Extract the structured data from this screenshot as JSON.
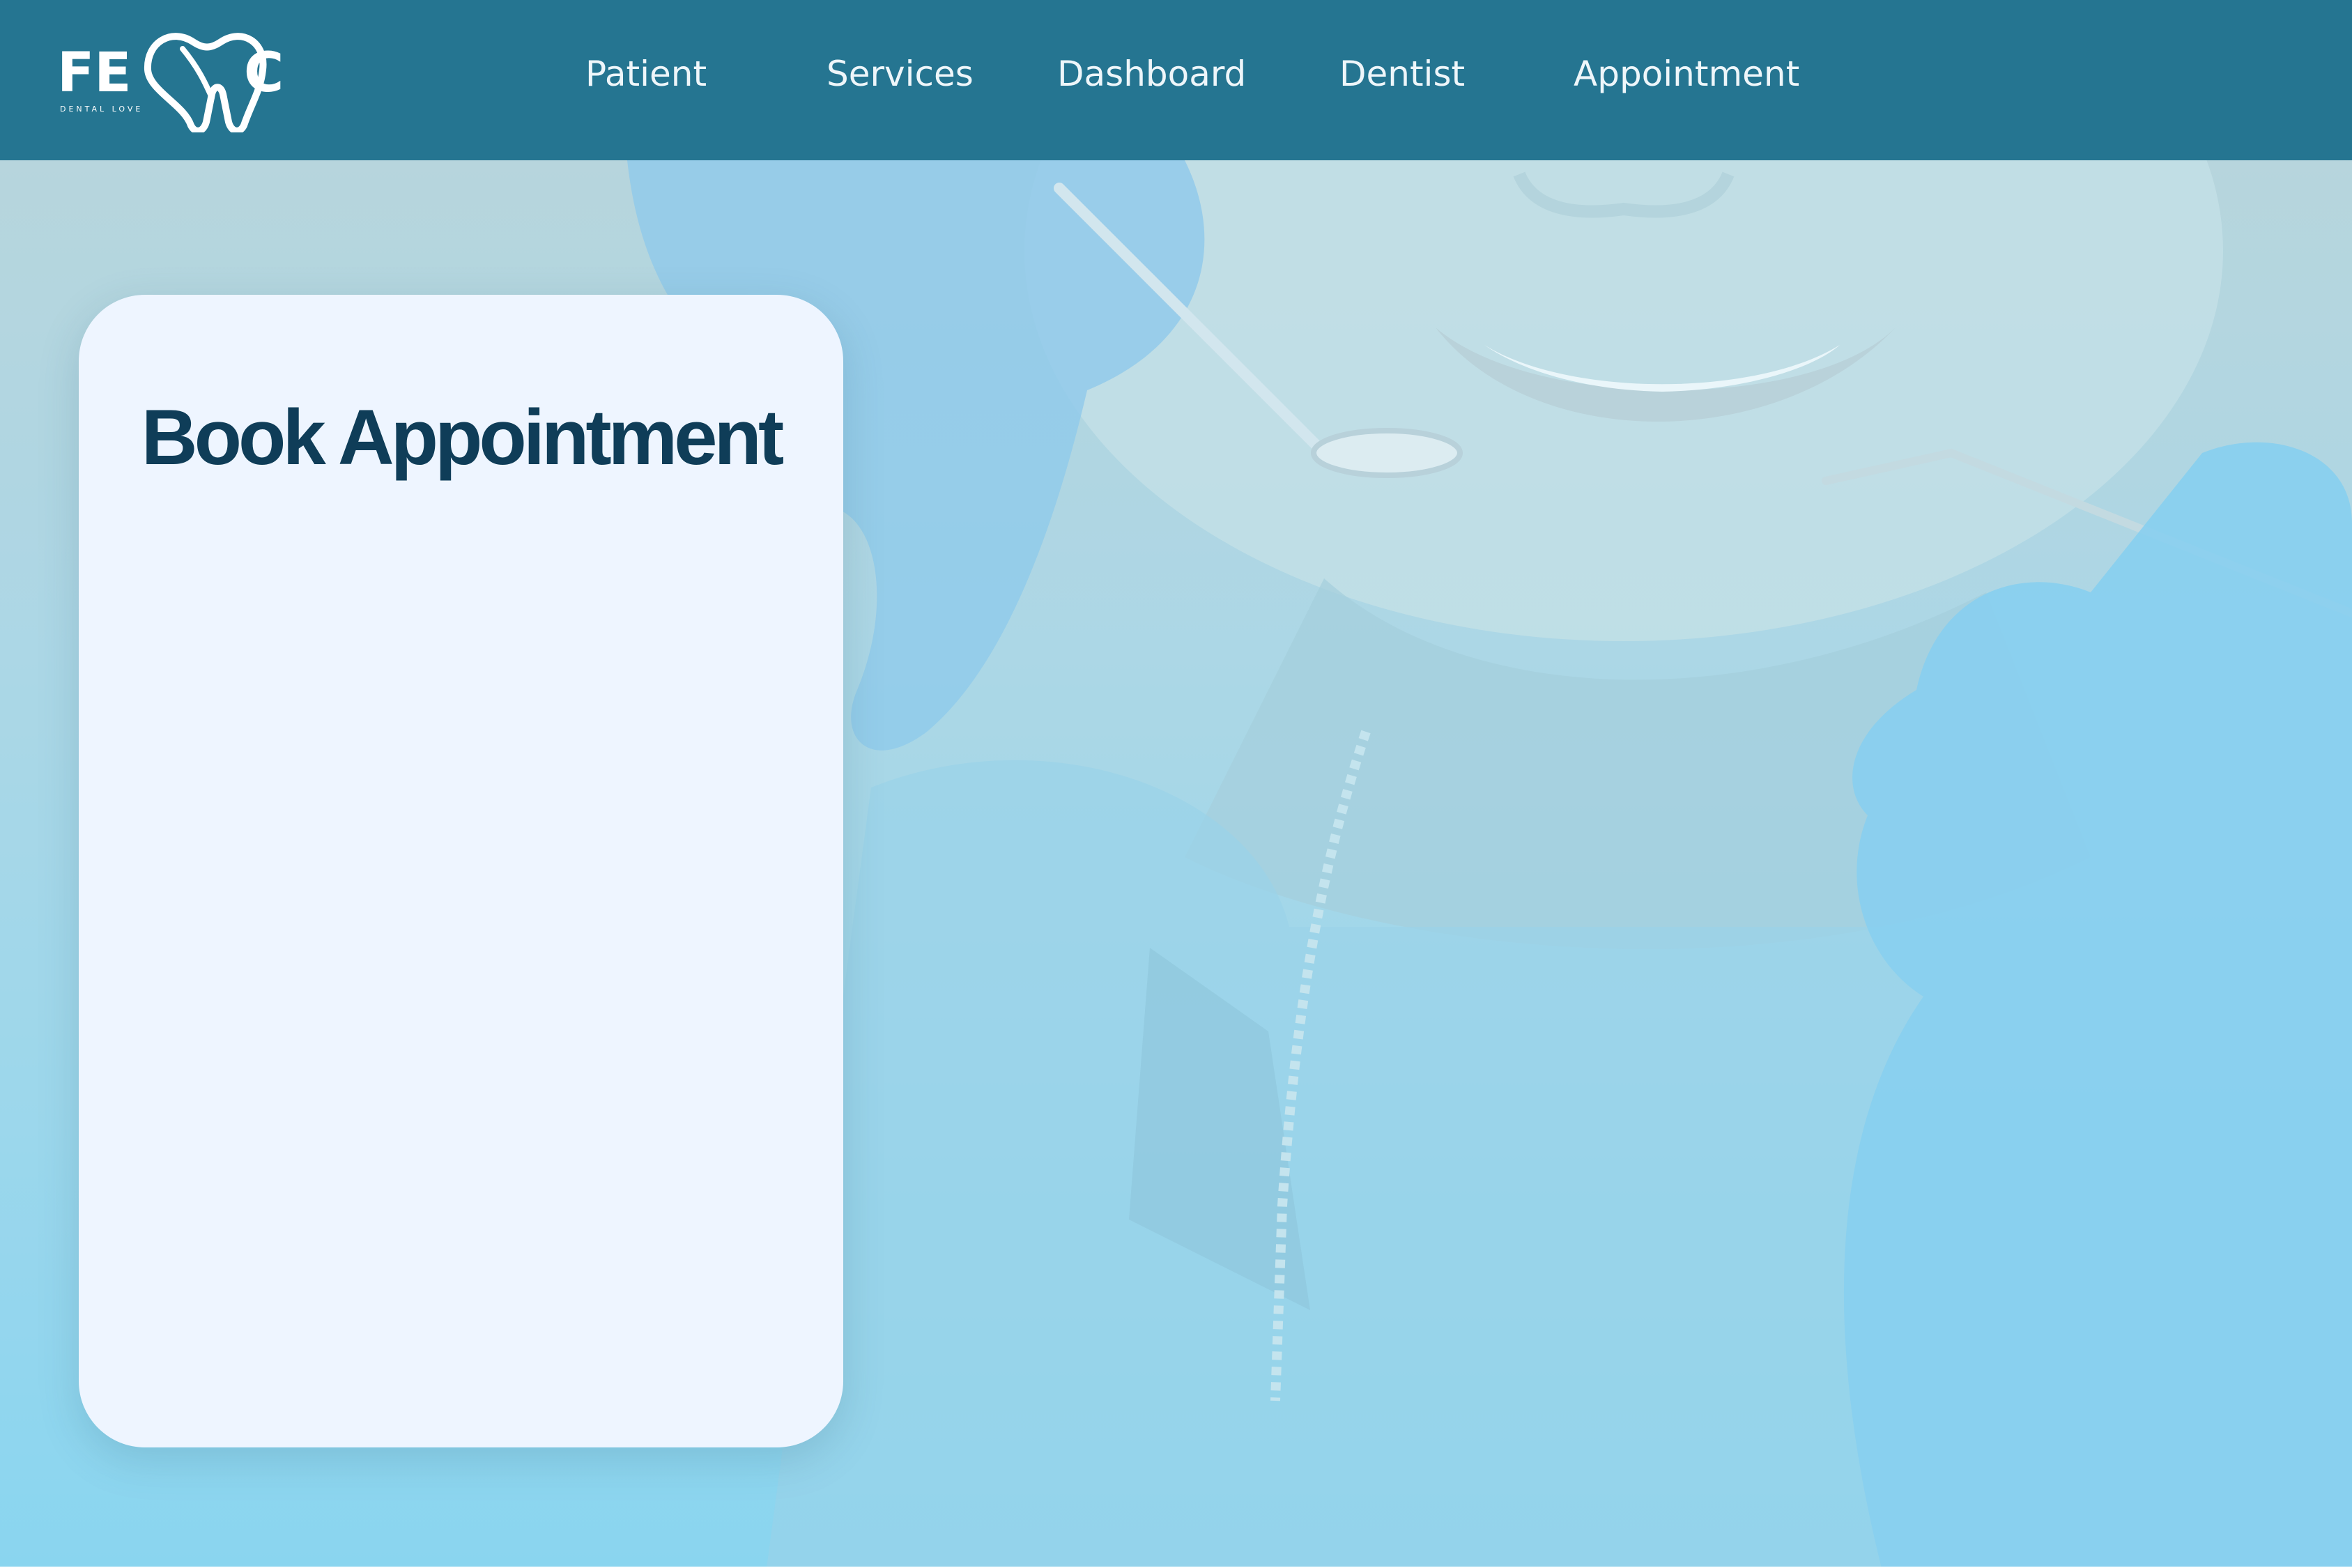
{
  "brand": {
    "logo_left": "FE",
    "logo_right": "C",
    "tagline": "DENTAL LOVE",
    "icon": "tooth-icon",
    "color": "#257591"
  },
  "nav": {
    "items": [
      {
        "label": "Patient"
      },
      {
        "label": "Services"
      },
      {
        "label": "Dashboard"
      },
      {
        "label": "Dentist"
      },
      {
        "label": "Appointment"
      }
    ]
  },
  "card": {
    "title": "Book Appointment"
  },
  "colors": {
    "header_bg": "#257591",
    "card_bg": "#eef5ff",
    "title_text": "#0f3d58",
    "nav_text": "#eef6fa"
  }
}
